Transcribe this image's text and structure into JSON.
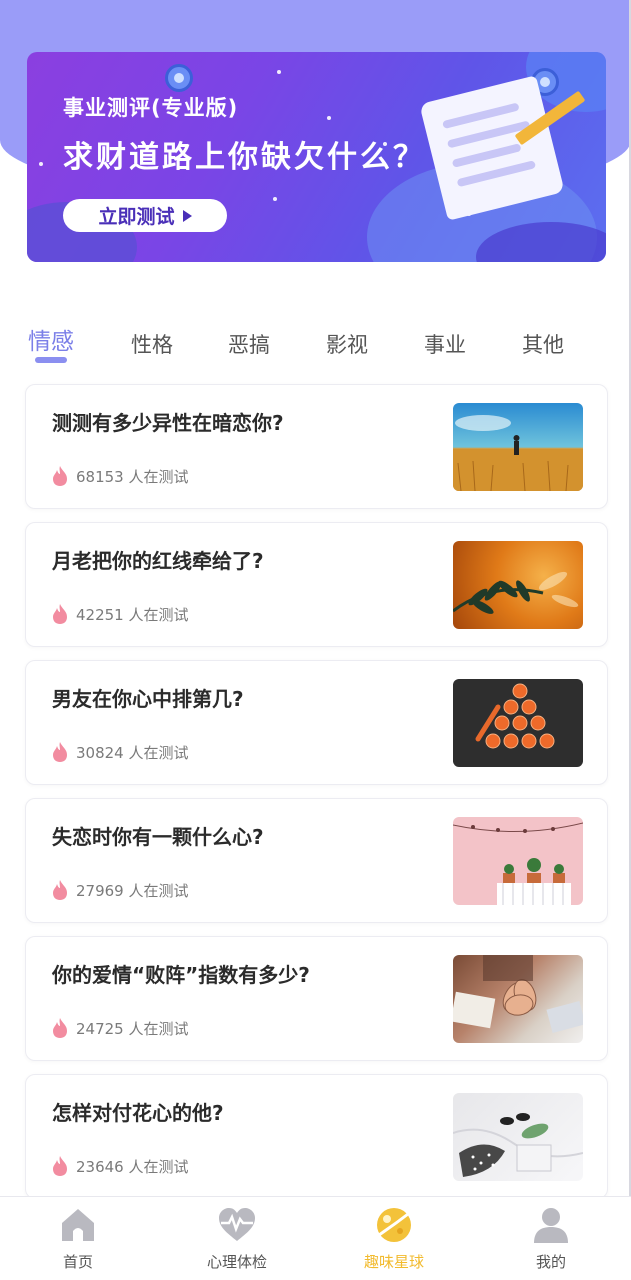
{
  "banner": {
    "subtitle": "事业测评(专业版)",
    "title": "求财道路上你缺欠什么？",
    "button_label": "立即测试"
  },
  "tabs": [
    {
      "label": "情感",
      "active": true
    },
    {
      "label": "性格",
      "active": false
    },
    {
      "label": "恶搞",
      "active": false
    },
    {
      "label": "影视",
      "active": false
    },
    {
      "label": "事业",
      "active": false
    },
    {
      "label": "其他",
      "active": false
    }
  ],
  "tests": [
    {
      "title": "测测有多少异性在暗恋你?",
      "count": "68153 人在测试",
      "image": "wheat-field-person"
    },
    {
      "title": "月老把你的红线牵给了?",
      "count": "42251 人在测试",
      "image": "plant-leaves-orange-light"
    },
    {
      "title": "男友在你心中排第几?",
      "count": "30824 人在测试",
      "image": "orange-slices-triangle"
    },
    {
      "title": "失恋时你有一颗什么心?",
      "count": "27969 人在测试",
      "image": "potted-plants-pink-wall"
    },
    {
      "title": "你的爱情“败阵”指数有多少?",
      "count": "24725 人在测试",
      "image": "team-hands-stack"
    },
    {
      "title": "怎样对付花心的他?",
      "count": "23646 人在测试",
      "image": "clothes-and-sunglasses"
    }
  ],
  "bottom_nav": [
    {
      "label": "首页",
      "icon": "home-icon",
      "active": false
    },
    {
      "label": "心理体检",
      "icon": "heartbeat-icon",
      "active": false
    },
    {
      "label": "趣味星球",
      "icon": "planet-icon",
      "active": true
    },
    {
      "label": "我的",
      "icon": "user-icon",
      "active": false
    }
  ],
  "colors": {
    "header_bg": "#9a9cf8",
    "tab_active": "#7b7fe8",
    "nav_active": "#f2bb2f",
    "flame": "#f28ca0"
  }
}
